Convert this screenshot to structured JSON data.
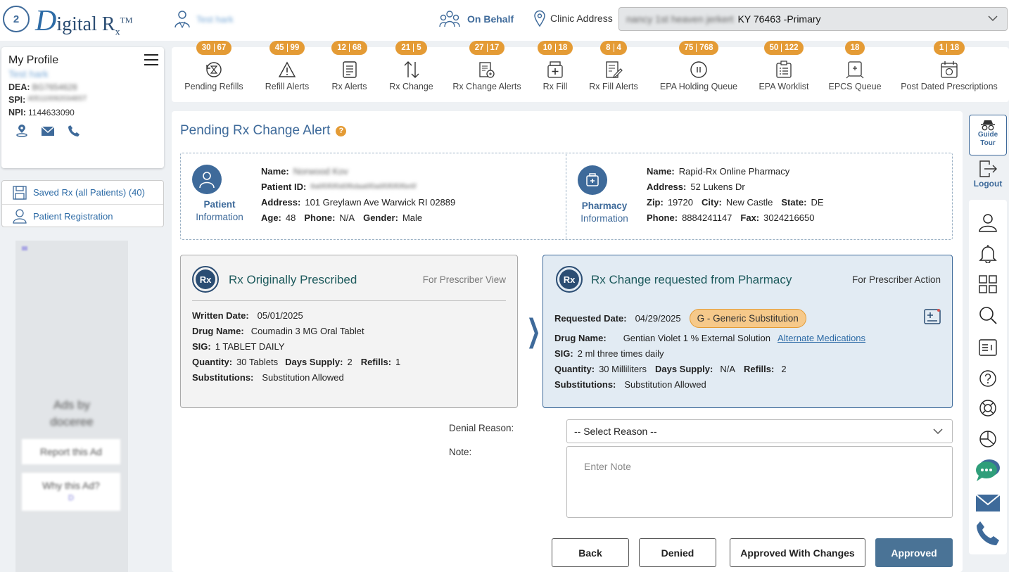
{
  "header": {
    "logo_mark": "2",
    "logo_d": "D",
    "logo_rest": "igital R",
    "logo_sub": "x",
    "logo_tm": "TM",
    "user_name": "Test hark",
    "on_behalf": "On Behalf",
    "clinic_label": "Clinic Address",
    "clinic_address_blurred": "nancy 1st heaven jerkert",
    "clinic_address_visible": "KY 76463 -Primary"
  },
  "profile": {
    "title": "My Profile",
    "name": "Test hark",
    "dea_label": "DEA:",
    "dea_value": "BG7654628",
    "spi_label": "SPI:",
    "spi_value": "4051100920348ST",
    "npi_label": "NPI:",
    "npi_value": "1144633090"
  },
  "sidebar": {
    "saved_rx": "Saved Rx (all Patients) (40)",
    "patient_registration": "Patient Registration"
  },
  "ad": {
    "title1": "Ads by",
    "title2": "doceree",
    "report": "Report this Ad",
    "why": "Why this Ad?",
    "why_icon": "D"
  },
  "nav": [
    {
      "label": "Pending Refills",
      "b1": "30",
      "b2": "67"
    },
    {
      "label": "Refill Alerts",
      "b1": "45",
      "b2": "99"
    },
    {
      "label": "Rx Alerts",
      "b1": "12",
      "b2": "68"
    },
    {
      "label": "Rx Change",
      "b1": "21",
      "b2": "5"
    },
    {
      "label": "Rx Change Alerts",
      "b1": "27",
      "b2": "17"
    },
    {
      "label": "Rx Fill",
      "b1": "10",
      "b2": "18"
    },
    {
      "label": "Rx Fill Alerts",
      "b1": "8",
      "b2": "4"
    },
    {
      "label": "EPA Holding Queue",
      "b1": "75",
      "b2": "768"
    },
    {
      "label": "EPA Worklist",
      "b1": "50",
      "b2": "122"
    },
    {
      "label": "EPCS Queue",
      "b1": "18"
    },
    {
      "label": "Post Dated Prescriptions",
      "b1": "1",
      "b2": "18"
    }
  ],
  "page": {
    "title": "Pending Rx Change Alert",
    "help": "?"
  },
  "patient": {
    "label1": "Patient",
    "label2": "Information",
    "name_label": "Name:",
    "name": "Norwood Kov",
    "id_label": "Patient ID:",
    "id": "8a6f0f0f0d0f6daa6f0a6f0f0f0f6e6f",
    "address_label": "Address:",
    "address": "101 Greylawn Ave Warwick RI 02889",
    "age_label": "Age:",
    "age": "48",
    "phone_label": "Phone:",
    "phone": "N/A",
    "gender_label": "Gender:",
    "gender": "Male"
  },
  "pharmacy": {
    "label1": "Pharmacy",
    "label2": "Information",
    "name_label": "Name:",
    "name": "Rapid-Rx Online Pharmacy",
    "address_label": "Address:",
    "address": "52 Lukens Dr",
    "zip_label": "Zip:",
    "zip": "19720",
    "city_label": "City:",
    "city": "New Castle",
    "state_label": "State:",
    "state": "DE",
    "phone_label": "Phone:",
    "phone": "8884241147",
    "fax_label": "Fax:",
    "fax": "3024216650"
  },
  "original": {
    "icon": "Rx",
    "title": "Rx Originally Prescribed",
    "sub": "For Prescriber View",
    "written_label": "Written Date:",
    "written": "05/01/2025",
    "drug_label": "Drug Name:",
    "drug": "Coumadin 3 MG Oral Tablet",
    "sig_label": "SIG:",
    "sig": "1 TABLET DAILY",
    "qty_label": "Quantity:",
    "qty": "30 Tablets",
    "days_label": "Days Supply:",
    "days": "2",
    "refills_label": "Refills:",
    "refills": "1",
    "subs_label": "Substitutions:",
    "subs": "Substitution Allowed"
  },
  "change": {
    "icon": "Rx",
    "title": "Rx Change requested from Pharmacy",
    "sub": "For Prescriber Action",
    "req_label": "Requested Date:",
    "req": "04/29/2025",
    "pill": "G - Generic Substitution",
    "drug_label": "Drug Name:",
    "drug": "Gentian Violet 1 % External Solution",
    "alt_link": "Alternate Medications",
    "sig_label": "SIG:",
    "sig": "2 ml three times daily",
    "qty_label": "Quantity:",
    "qty": "30 Milliliters",
    "days_label": "Days Supply:",
    "days": "N/A",
    "refills_label": "Refills:",
    "refills": "2",
    "subs_label": "Substitutions:",
    "subs": "Substitution Allowed"
  },
  "chevron": "❯",
  "form": {
    "denial_label": "Denial Reason:",
    "denial_value": "-- Select Reason --",
    "note_label": "Note:",
    "note_placeholder": "Enter Note"
  },
  "buttons": {
    "back": "Back",
    "denied": "Denied",
    "approved_changes": "Approved With Changes",
    "approved": "Approved"
  },
  "right": {
    "guide1": "Guide",
    "guide2": "Tour",
    "logout": "Logout"
  },
  "colors": {
    "primary": "#3e6a9a",
    "badge": "#e49b35",
    "button_primary": "#4a7396"
  }
}
